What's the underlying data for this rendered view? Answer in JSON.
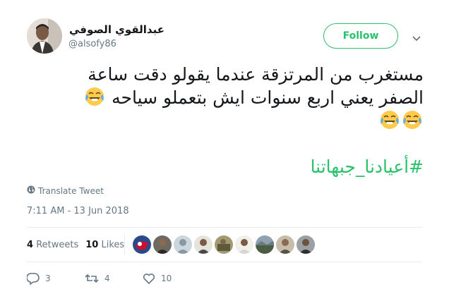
{
  "author": {
    "display_name": "عبدالقوي الصوفي",
    "handle": "@alsofy86"
  },
  "follow_label": "Follow",
  "tweet": {
    "line1": "مستغرب من المرتزقة  عندما يقولو دقت ساعة",
    "line2": "الصفر يعني اربع سنوات ايش بتعملو  سياحه",
    "hashtag": "#أعيادنا_جبهاتنا"
  },
  "translate_label": "Translate Tweet",
  "timestamp": "7:11 AM - 13 Jun 2018",
  "stats": {
    "retweets_count": "4",
    "retweets_label": "Retweets",
    "likes_count": "10",
    "likes_label": "Likes"
  },
  "actions": {
    "replies": "3",
    "retweets": "4",
    "likes": "10"
  },
  "colors": {
    "accent": "#29c16b",
    "text": "#14171a",
    "muted": "#657786",
    "border": "#e6ecf0"
  },
  "icons": [
    "chevron-down-icon",
    "globe-icon",
    "reply-icon",
    "retweet-icon",
    "heart-icon",
    "face-with-tears-of-joy-emoji"
  ]
}
